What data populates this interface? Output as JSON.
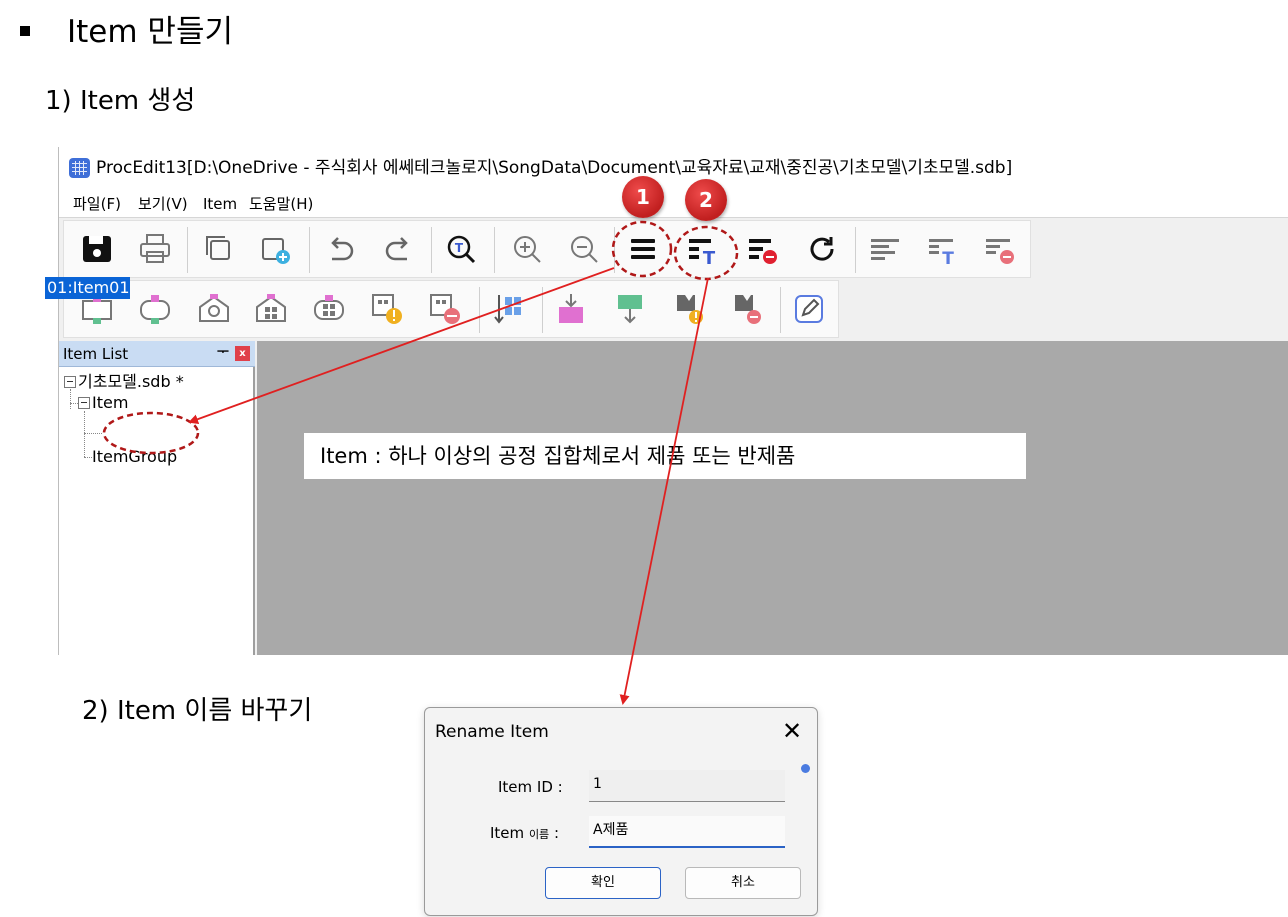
{
  "doc": {
    "heading": "Item 만들기",
    "step1": "1) Item 생성",
    "step2": "2) Item 이름 바꾸기",
    "callout": "Item : 하나 이상의 공정 집합체로서 제품 또는 반제품",
    "badges": [
      "1",
      "2"
    ],
    "accent_color": "#e02020"
  },
  "window": {
    "title": "ProcEdit13[D:\\OneDrive - 주식회사 에쎄테크놀로지\\SongData\\Document\\교육자료\\교재\\중진공\\기초모델\\기초모델.sdb]",
    "menu": [
      "파일(F)",
      "보기(V)",
      "Item",
      "도움말(H)"
    ],
    "toolbar1_icons": [
      "save-icon",
      "print-icon",
      "copy-icon",
      "add-window-icon",
      "undo-icon",
      "redo-icon",
      "find-text-icon",
      "zoom-in-icon",
      "zoom-out-icon",
      "item-list-icon",
      "rename-item-icon",
      "delete-item-icon",
      "refresh-icon",
      "align-icon",
      "text-align-icon",
      "remove-align-icon"
    ],
    "toolbar2_icons": [
      "process-box-icon",
      "process-rounded-icon",
      "process-search-icon",
      "process-group-icon",
      "process-group-alt-icon",
      "process-warning-icon",
      "process-remove-icon",
      "arrange-icon",
      "insert-down-icon",
      "move-down-icon",
      "flag-warning-icon",
      "flag-remove-icon",
      "edit-icon"
    ]
  },
  "item_list": {
    "title": "Item List",
    "pin": "ᅮ",
    "close": "x",
    "root": "기초모델.sdb *",
    "node_item": "Item",
    "selected": "01:Item01",
    "node_group": "ItemGroup"
  },
  "dialog": {
    "title": "Rename Item",
    "close": "✕",
    "id_label": "Item ID :",
    "id_value": "1",
    "name_label_main": "Item",
    "name_label_small": "이름",
    "name_label_colon": ":",
    "name_value": "A제품",
    "ok": "확인",
    "cancel": "취소"
  }
}
